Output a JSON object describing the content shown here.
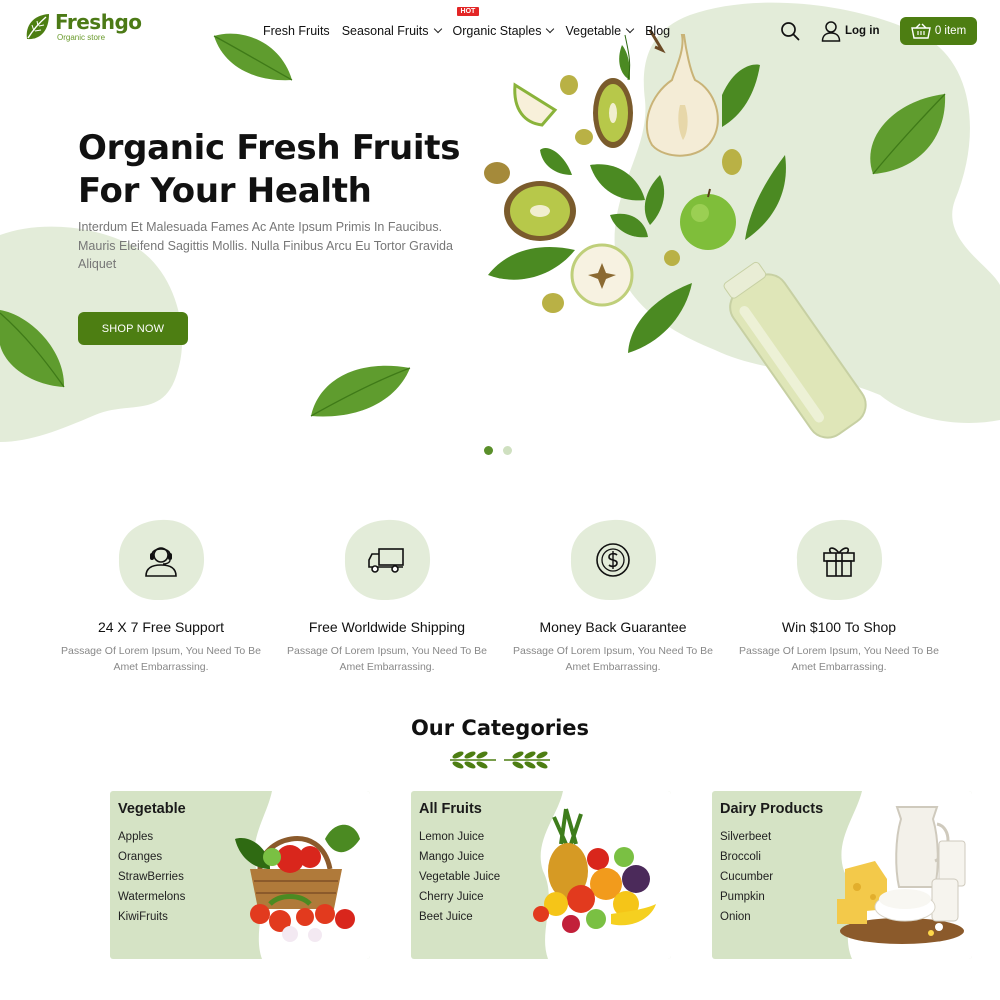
{
  "brand": {
    "name": "Freshgo",
    "tagline": "Organic store",
    "color": "#4d7e12"
  },
  "nav": {
    "items": [
      {
        "label": "Fresh Fruits",
        "dropdown": false
      },
      {
        "label": "Seasonal Fruits",
        "dropdown": true
      },
      {
        "label": "Organic Staples",
        "dropdown": true,
        "badge": "HOT"
      },
      {
        "label": "Vegetable",
        "dropdown": true
      },
      {
        "label": "Blog",
        "dropdown": false
      }
    ],
    "search_icon": "search-icon",
    "login_label": "Log in",
    "cart_label": "0 item"
  },
  "hero": {
    "title_line1": "Organic Fresh Fruits",
    "title_line2": "For Your Health",
    "description": "Interdum Et Malesuada Fames Ac Ante Ipsum Primis In Faucibus. Mauris Eleifend Sagittis Mollis. Nulla Finibus Arcu Eu Tortor Gravida Aliquet",
    "cta_label": "SHOP NOW",
    "slide_count": 2,
    "active_slide": 1
  },
  "features": [
    {
      "icon": "headset-support-icon",
      "title": "24 X 7 Free Support",
      "desc": "Passage Of Lorem Ipsum, You Need To Be Amet Embarrassing."
    },
    {
      "icon": "delivery-truck-icon",
      "title": "Free Worldwide Shipping",
      "desc": "Passage Of Lorem Ipsum, You Need To Be Amet Embarrassing."
    },
    {
      "icon": "dollar-coin-icon",
      "title": "Money Back Guarantee",
      "desc": "Passage Of Lorem Ipsum, You Need To Be Amet Embarrassing."
    },
    {
      "icon": "gift-box-icon",
      "title": "Win $100 To Shop",
      "desc": "Passage Of Lorem Ipsum, You Need To Be Amet Embarrassing."
    }
  ],
  "categories": {
    "heading": "Our Categories",
    "cards": [
      {
        "title": "Vegetable",
        "items": [
          "Apples",
          "Oranges",
          "StrawBerries",
          "Watermelons",
          "KiwiFruits"
        ],
        "image": "vegetable-basket-image"
      },
      {
        "title": "All Fruits",
        "items": [
          "Lemon Juice",
          "Mango Juice",
          "Vegetable Juice",
          "Cherry Juice",
          "Beet Juice"
        ],
        "image": "fruit-pile-image"
      },
      {
        "title": "Dairy Products",
        "items": [
          "Silverbeet",
          "Broccoli",
          "Cucumber",
          "Pumpkin",
          "Onion"
        ],
        "image": "dairy-products-image"
      }
    ]
  },
  "colors": {
    "accent": "#4d7e12",
    "blob": "#e3ecd9",
    "card": "#d5e3c5",
    "hot": "#e32626"
  }
}
